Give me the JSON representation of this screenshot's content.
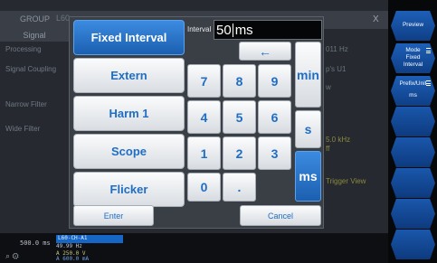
{
  "app": {
    "group_label": "GROUP",
    "tab_label": "L60",
    "close_label": "X",
    "column_header": "Signal",
    "left_labels": [
      "Processing",
      "Signal Coupling",
      "Narrow Filter",
      "Wide Filter"
    ],
    "right_values": [
      "011 Hz",
      "p's U1",
      "w",
      "5.0 kHz",
      "ff",
      "Trigger View"
    ]
  },
  "status": {
    "time": "500.0 ms",
    "channel": "L60-CH-A1",
    "line1": "49.99  Hz",
    "line2": "A 250.0 V",
    "line3": "A 600.0 mA"
  },
  "softkeys": [
    {
      "label": "Preview",
      "sub": ""
    },
    {
      "label": "Mode",
      "sub": "Fixed Interval",
      "menu": true
    },
    {
      "label": "Prefix/Unit",
      "sub": "ms",
      "menu": true
    },
    {
      "label": "",
      "sub": ""
    },
    {
      "label": "",
      "sub": ""
    },
    {
      "label": "",
      "sub": ""
    },
    {
      "label": "",
      "sub": ""
    },
    {
      "label": "",
      "sub": ""
    }
  ],
  "dialog": {
    "modes": [
      "Fixed Interval",
      "Extern",
      "Harm 1",
      "Scope",
      "Flicker"
    ],
    "active_mode": "Fixed Interval",
    "interval_label": "Interval",
    "interval_value": "50",
    "interval_unit": "ms",
    "backspace": "←",
    "keys": [
      "7",
      "8",
      "9",
      "4",
      "5",
      "6",
      "1",
      "2",
      "3",
      "0",
      "."
    ],
    "units": [
      "min",
      "s",
      "ms"
    ],
    "active_unit": "ms",
    "enter_label": "Enter",
    "cancel_label": "Cancel"
  },
  "colors": {
    "accent": "#1f6ec3",
    "active_blue": "#2a74cc",
    "softkey_blue": "#1a57ab"
  }
}
